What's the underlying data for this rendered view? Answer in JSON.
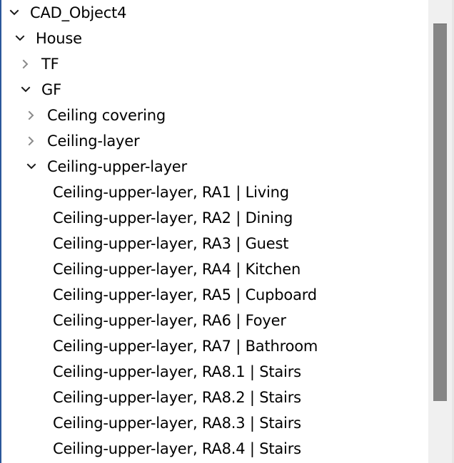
{
  "tree": {
    "nodes": [
      {
        "label": "CAD_Object4",
        "level": 0,
        "state": "expanded",
        "icon": "chevron-down-icon"
      },
      {
        "label": "House",
        "level": 1,
        "state": "expanded",
        "icon": "chevron-down-icon"
      },
      {
        "label": "TF",
        "level": 2,
        "state": "collapsed",
        "icon": "chevron-right-icon"
      },
      {
        "label": "GF",
        "level": 2,
        "state": "expanded",
        "icon": "chevron-down-icon"
      },
      {
        "label": "Ceiling covering",
        "level": 3,
        "state": "collapsed",
        "icon": "chevron-right-icon"
      },
      {
        "label": "Ceiling-layer",
        "level": 3,
        "state": "collapsed",
        "icon": "chevron-right-icon"
      },
      {
        "label": "Ceiling-upper-layer",
        "level": 3,
        "state": "expanded",
        "icon": "chevron-down-icon"
      },
      {
        "label": "Ceiling-upper-layer, RA1 | Living",
        "level": 4,
        "state": "leaf"
      },
      {
        "label": "Ceiling-upper-layer, RA2 | Dining",
        "level": 4,
        "state": "leaf"
      },
      {
        "label": "Ceiling-upper-layer, RA3 | Guest",
        "level": 4,
        "state": "leaf"
      },
      {
        "label": "Ceiling-upper-layer, RA4 | Kitchen",
        "level": 4,
        "state": "leaf"
      },
      {
        "label": "Ceiling-upper-layer, RA5 | Cupboard",
        "level": 4,
        "state": "leaf"
      },
      {
        "label": "Ceiling-upper-layer, RA6 | Foyer",
        "level": 4,
        "state": "leaf"
      },
      {
        "label": "Ceiling-upper-layer, RA7 | Bathroom",
        "level": 4,
        "state": "leaf"
      },
      {
        "label": "Ceiling-upper-layer, RA8.1 | Stairs",
        "level": 4,
        "state": "leaf"
      },
      {
        "label": "Ceiling-upper-layer, RA8.2 | Stairs",
        "level": 4,
        "state": "leaf"
      },
      {
        "label": "Ceiling-upper-layer, RA8.3 | Stairs",
        "level": 4,
        "state": "leaf"
      },
      {
        "label": "Ceiling-upper-layer, RA8.4 | Stairs",
        "level": 4,
        "state": "leaf"
      }
    ]
  },
  "colors": {
    "focus_border": "#2b579a",
    "expanded_chevron": "#1a1a1a",
    "collapsed_chevron": "#8a8a8a",
    "scrollbar_track": "#f0f0f0",
    "scrollbar_thumb": "#858585"
  },
  "scrollbar": {
    "orientation": "vertical"
  }
}
